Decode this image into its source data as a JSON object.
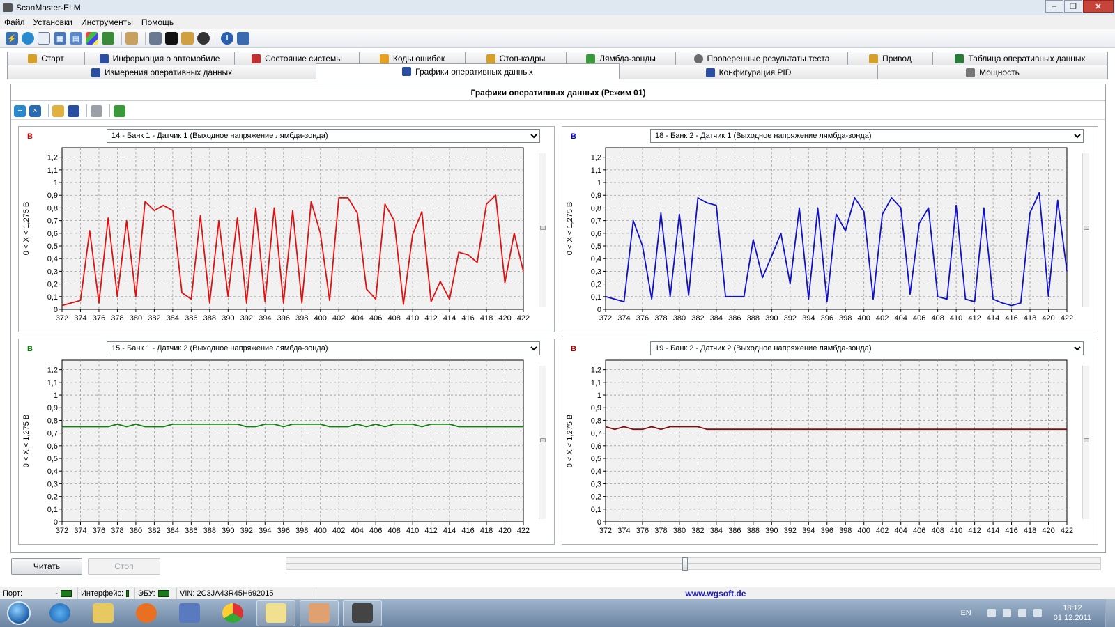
{
  "window": {
    "title": "ScanMaster-ELM"
  },
  "menu": [
    "Файл",
    "Установки",
    "Инструменты",
    "Помощь"
  ],
  "toolbar_icons": [
    "connect-icon",
    "globe-icon",
    "document-icon",
    "table-icon",
    "chart-icon",
    "windows-icon",
    "battery-icon",
    "clipboard-icon",
    "monitor-icon",
    "terminal-icon",
    "bottle-icon",
    "stop-icon",
    "info-icon",
    "exit-icon"
  ],
  "tabs_row1": [
    {
      "label": "Старт",
      "icon": "start-icon",
      "color": "#d4a02a"
    },
    {
      "label": "Информация о автомобиле",
      "icon": "info-icon",
      "color": "#2a4fa0"
    },
    {
      "label": "Состояние системы",
      "icon": "system-icon",
      "color": "#c03030"
    },
    {
      "label": "Коды ошибок",
      "icon": "warning-icon",
      "color": "#e8a020"
    },
    {
      "label": "Стоп-кадры",
      "icon": "freeze-icon",
      "color": "#d4a02a"
    },
    {
      "label": "Лямбда-зонды",
      "icon": "lambda-icon",
      "color": "#3a9a3a"
    },
    {
      "label": "Проверенные результаты теста",
      "icon": "gear-icon",
      "color": "#6a6a6a"
    },
    {
      "label": "Привод",
      "icon": "drive-icon",
      "color": "#d4a02a"
    },
    {
      "label": "Таблица оперативных данных",
      "icon": "table-icon",
      "color": "#2a7a3a"
    }
  ],
  "tabs_row2": [
    {
      "label": "Измерения оперативных данных",
      "icon": "measure-icon",
      "color": "#2a4fa0"
    },
    {
      "label": "Графики оперативных данных",
      "icon": "chart-icon",
      "color": "#2a4fa0",
      "active": true
    },
    {
      "label": "Конфигурация PID",
      "icon": "config-icon",
      "color": "#2a4fa0"
    },
    {
      "label": "Мощность",
      "icon": "power-icon",
      "color": "#777777"
    }
  ],
  "content": {
    "header": "Графики оперативных данных (Режим 01)",
    "tool_icons": [
      "add-chart-icon",
      "remove-chart-icon",
      "open-icon",
      "save-icon",
      "print-icon",
      "export-icon"
    ]
  },
  "chart_data": [
    {
      "type": "line",
      "unit": "B",
      "unit_color": "#d00000",
      "selector": "14 - Банк 1 - Датчик 1 (Выходное напряжение лямбда-зонда)",
      "ylabel": "0  < X <  1,275 В",
      "series_color": "#e01010",
      "ylim": [
        0,
        1.275
      ],
      "yticks": [
        "0",
        "0,1",
        "0,2",
        "0,3",
        "0,4",
        "0,5",
        "0,6",
        "0,7",
        "0,8",
        "0,9",
        "1",
        "1,1",
        "1,2"
      ],
      "xlim": [
        372,
        422
      ],
      "xticks": [
        372,
        374,
        376,
        378,
        380,
        382,
        384,
        386,
        388,
        390,
        392,
        394,
        396,
        398,
        400,
        402,
        404,
        406,
        408,
        410,
        412,
        414,
        416,
        418,
        420,
        422
      ],
      "x": [
        372,
        374,
        375,
        376,
        377,
        378,
        379,
        380,
        381,
        382,
        383,
        384,
        385,
        386,
        387,
        388,
        389,
        390,
        391,
        392,
        393,
        394,
        395,
        396,
        397,
        398,
        399,
        400,
        401,
        402,
        403,
        404,
        405,
        406,
        407,
        408,
        409,
        410,
        411,
        412,
        413,
        414,
        415,
        416,
        417,
        418,
        419,
        420,
        421,
        422
      ],
      "y": [
        0.03,
        0.07,
        0.62,
        0.05,
        0.72,
        0.1,
        0.7,
        0.1,
        0.85,
        0.78,
        0.82,
        0.78,
        0.13,
        0.08,
        0.74,
        0.05,
        0.7,
        0.1,
        0.72,
        0.05,
        0.8,
        0.06,
        0.8,
        0.05,
        0.78,
        0.05,
        0.85,
        0.6,
        0.07,
        0.88,
        0.88,
        0.76,
        0.16,
        0.08,
        0.83,
        0.7,
        0.04,
        0.59,
        0.77,
        0.06,
        0.22,
        0.08,
        0.45,
        0.43,
        0.37,
        0.83,
        0.9,
        0.21,
        0.6,
        0.3
      ]
    },
    {
      "type": "line",
      "unit": "B",
      "unit_color": "#0000c0",
      "selector": "18 - Банк 2 - Датчик 1 (Выходное напряжение лямбда-зонда)",
      "ylabel": "0  < X <  1,275 В",
      "series_color": "#1010c8",
      "ylim": [
        0,
        1.275
      ],
      "yticks": [
        "0",
        "0,1",
        "0,2",
        "0,3",
        "0,4",
        "0,5",
        "0,6",
        "0,7",
        "0,8",
        "0,9",
        "1",
        "1,1",
        "1,2"
      ],
      "xlim": [
        372,
        422
      ],
      "xticks": [
        372,
        374,
        376,
        378,
        380,
        382,
        384,
        386,
        388,
        390,
        392,
        394,
        396,
        398,
        400,
        402,
        404,
        406,
        408,
        410,
        412,
        414,
        416,
        418,
        420,
        422
      ],
      "x": [
        372,
        374,
        375,
        376,
        377,
        378,
        379,
        380,
        381,
        382,
        383,
        384,
        385,
        386,
        387,
        388,
        389,
        390,
        391,
        392,
        393,
        394,
        395,
        396,
        397,
        398,
        399,
        400,
        401,
        402,
        403,
        404,
        405,
        406,
        407,
        408,
        409,
        410,
        411,
        412,
        413,
        414,
        415,
        416,
        417,
        418,
        419,
        420,
        421,
        422
      ],
      "y": [
        0.1,
        0.06,
        0.7,
        0.5,
        0.08,
        0.76,
        0.1,
        0.75,
        0.11,
        0.88,
        0.84,
        0.82,
        0.1,
        0.1,
        0.1,
        0.55,
        0.25,
        0.42,
        0.6,
        0.2,
        0.8,
        0.08,
        0.8,
        0.06,
        0.75,
        0.62,
        0.88,
        0.77,
        0.08,
        0.75,
        0.88,
        0.8,
        0.12,
        0.68,
        0.8,
        0.1,
        0.08,
        0.82,
        0.08,
        0.06,
        0.8,
        0.08,
        0.05,
        0.03,
        0.05,
        0.76,
        0.92,
        0.1,
        0.86,
        0.3
      ]
    },
    {
      "type": "line",
      "unit": "B",
      "unit_color": "#008000",
      "selector": "15 - Банк 1 - Датчик 2 (Выходное напряжение лямбда-зонда)",
      "ylabel": "0  < X <  1,275 В",
      "series_color": "#108010",
      "ylim": [
        0,
        1.275
      ],
      "yticks": [
        "0",
        "0,1",
        "0,2",
        "0,3",
        "0,4",
        "0,5",
        "0,6",
        "0,7",
        "0,8",
        "0,9",
        "1",
        "1,1",
        "1,2"
      ],
      "xlim": [
        372,
        422
      ],
      "xticks": [
        372,
        374,
        376,
        378,
        380,
        382,
        384,
        386,
        388,
        390,
        392,
        394,
        396,
        398,
        400,
        402,
        404,
        406,
        408,
        410,
        412,
        414,
        416,
        418,
        420,
        422
      ],
      "x": [
        372,
        374,
        376,
        377,
        378,
        379,
        380,
        381,
        382,
        383,
        384,
        385,
        386,
        388,
        390,
        391,
        392,
        393,
        394,
        395,
        396,
        397,
        398,
        399,
        400,
        401,
        402,
        403,
        404,
        405,
        406,
        407,
        408,
        409,
        410,
        411,
        412,
        413,
        414,
        415,
        416,
        418,
        420,
        422
      ],
      "y": [
        0.75,
        0.75,
        0.75,
        0.75,
        0.77,
        0.75,
        0.77,
        0.75,
        0.75,
        0.75,
        0.77,
        0.77,
        0.77,
        0.77,
        0.77,
        0.77,
        0.75,
        0.75,
        0.77,
        0.77,
        0.75,
        0.77,
        0.77,
        0.77,
        0.77,
        0.75,
        0.75,
        0.75,
        0.77,
        0.75,
        0.77,
        0.75,
        0.77,
        0.77,
        0.77,
        0.75,
        0.77,
        0.77,
        0.77,
        0.75,
        0.75,
        0.75,
        0.75,
        0.75
      ]
    },
    {
      "type": "line",
      "unit": "B",
      "unit_color": "#a00000",
      "selector": "19 - Банк 2 - Датчик 2 (Выходное напряжение лямбда-зонда)",
      "ylabel": "0  < X <  1,275 В",
      "series_color": "#801010",
      "ylim": [
        0,
        1.275
      ],
      "yticks": [
        "0",
        "0,1",
        "0,2",
        "0,3",
        "0,4",
        "0,5",
        "0,6",
        "0,7",
        "0,8",
        "0,9",
        "1",
        "1,1",
        "1,2"
      ],
      "xlim": [
        372,
        422
      ],
      "xticks": [
        372,
        374,
        376,
        378,
        380,
        382,
        384,
        386,
        388,
        390,
        392,
        394,
        396,
        398,
        400,
        402,
        404,
        406,
        408,
        410,
        412,
        414,
        416,
        418,
        420,
        422
      ],
      "x": [
        372,
        373,
        374,
        375,
        376,
        377,
        378,
        379,
        380,
        381,
        382,
        383,
        384,
        386,
        388,
        390,
        400,
        410,
        422
      ],
      "y": [
        0.75,
        0.73,
        0.75,
        0.73,
        0.73,
        0.75,
        0.73,
        0.75,
        0.75,
        0.75,
        0.75,
        0.73,
        0.73,
        0.73,
        0.73,
        0.73,
        0.73,
        0.73,
        0.73
      ]
    }
  ],
  "buttons": {
    "read": "Читать",
    "stop": "Стоп"
  },
  "slider": {
    "position": 0.49
  },
  "status": {
    "port_label": "Порт:",
    "port_value": "-",
    "interface_label": "Интерфейс:",
    "ecu_label": "ЭБУ:",
    "vin": "VIN: 2C3JA43R45H692015",
    "url": "www.wgsoft.de",
    "led_color": "#1c7a1c"
  },
  "taskbar": {
    "items": [
      "ie-icon",
      "explorer-icon",
      "media-player-icon",
      "tools-icon",
      "chrome-icon",
      "folder-icon",
      "touch-icon",
      "chip-icon"
    ],
    "lang": "EN",
    "time": "18:12",
    "date": "01.12.2011"
  }
}
